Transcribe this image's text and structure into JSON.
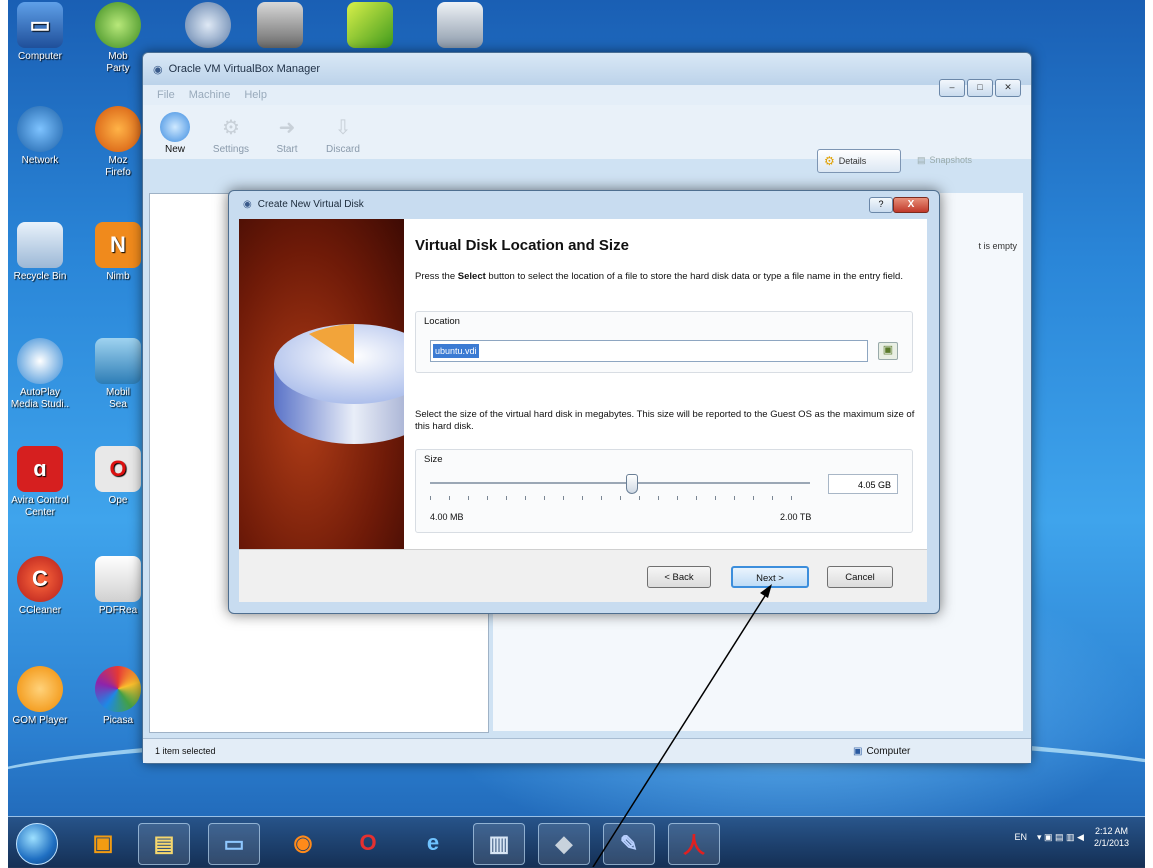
{
  "desktop": {
    "icons": [
      {
        "label": "Computer",
        "icon": "computer-icon"
      },
      {
        "label": "Mob\nParty",
        "icon": "mobile-partner-icon"
      },
      {
        "label": "Network",
        "icon": "network-icon"
      },
      {
        "label": "Moz\nFirefo",
        "icon": "firefox-icon"
      },
      {
        "label": "Recycle Bin",
        "icon": "recycle-bin-icon"
      },
      {
        "label": "Nimb",
        "icon": "nimbuzz-icon"
      },
      {
        "label": "AutoPlay\nMedia Studi..",
        "icon": "autoplay-icon"
      },
      {
        "label": "Mobil\nSea",
        "icon": "mobile-search-icon"
      },
      {
        "label": "Avira Control\nCenter",
        "icon": "avira-icon"
      },
      {
        "label": "Ope",
        "icon": "opera-icon"
      },
      {
        "label": "CCleaner",
        "icon": "ccleaner-icon"
      },
      {
        "label": "PDFRea",
        "icon": "pdf-reader-icon"
      },
      {
        "label": "GOM Player",
        "icon": "gom-player-icon"
      },
      {
        "label": "Picasa",
        "icon": "picasa-icon"
      }
    ]
  },
  "vbox": {
    "title": "Oracle VM VirtualBox Manager",
    "menu": [
      "File",
      "Machine",
      "Help"
    ],
    "toolbar": [
      "New",
      "Settings",
      "Start",
      "Discard"
    ],
    "details_label": "Details",
    "snapshots_label": "Snapshots",
    "right_note": "t is empty",
    "status_left": "1 item selected",
    "status_right": "Computer"
  },
  "dialog": {
    "title": "Create New Virtual Disk",
    "heading": "Virtual Disk Location and Size",
    "intro_pre": "Press the ",
    "intro_bold": "Select",
    "intro_post": " button to select the location of a file to store the hard disk data or type a file name in the entry field.",
    "location_label": "Location",
    "location_value": "ubuntu.vdi",
    "size_text": "Select the size of the virtual hard disk in megabytes. This size will be reported to the Guest OS as the maximum size of this hard disk.",
    "size_label": "Size",
    "size_value": "4.05 GB",
    "size_min": "4.00 MB",
    "size_max": "2.00 TB",
    "slider_fraction": 0.53,
    "back_label": "< Back",
    "next_label": "Next >",
    "cancel_label": "Cancel",
    "help_label": "?",
    "close_label": "X"
  },
  "taskbar": {
    "items": [
      "start-orb",
      "media-player",
      "explorer",
      "remote-desktop",
      "firefox",
      "opera",
      "internet-explorer",
      "notepad",
      "virtualbox",
      "paint",
      "acrobat"
    ],
    "lang": "EN",
    "time": "2:12 AM",
    "date": "2/1/2013"
  },
  "colors": {
    "accent": "#3c8edc",
    "close": "#c0392b",
    "selection": "#3b7bd3"
  }
}
